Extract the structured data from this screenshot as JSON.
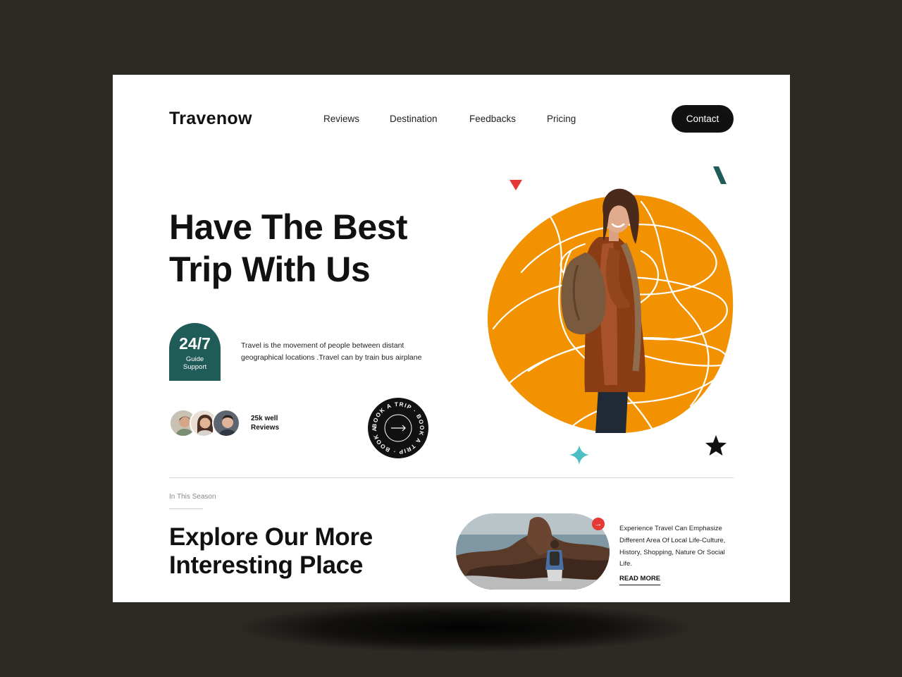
{
  "header": {
    "logo": "Travenow",
    "nav": [
      "Reviews",
      "Destination",
      "Feedbacks",
      "Pricing"
    ],
    "contact_label": "Contact"
  },
  "hero": {
    "title_line1": "Have The Best",
    "title_line2": "Trip With Us",
    "badge_big": "24/7",
    "badge_small": "Guide Support",
    "description": "Travel is the movement  of people between distant geographical locations .Travel can by train bus airplane",
    "reviews_line1": "25k well",
    "reviews_line2": "Reviews",
    "book_ring_text": "BOOK A TRIP · BOOK A TRIP · BOOK A TRIP ·"
  },
  "explore": {
    "season_label": "In This Season",
    "title_line1": "Explore Our More",
    "title_line2": "Interesting Place",
    "description": "Experience Travel Can Emphasize Different Area Of Local Life-Culture, History, Shopping, Nature Or Social Life.",
    "read_more": "READ MORE"
  },
  "icons": {
    "arrow": "right-arrow-icon",
    "star": "star-icon",
    "sparkle": "sparkle-icon",
    "triangle": "triangle-icon"
  },
  "colors": {
    "accent_orange": "#f39200",
    "badge_green": "#1f5c58",
    "dark": "#111111",
    "red": "#e53935",
    "teal_sparkle": "#4bbfc4"
  }
}
